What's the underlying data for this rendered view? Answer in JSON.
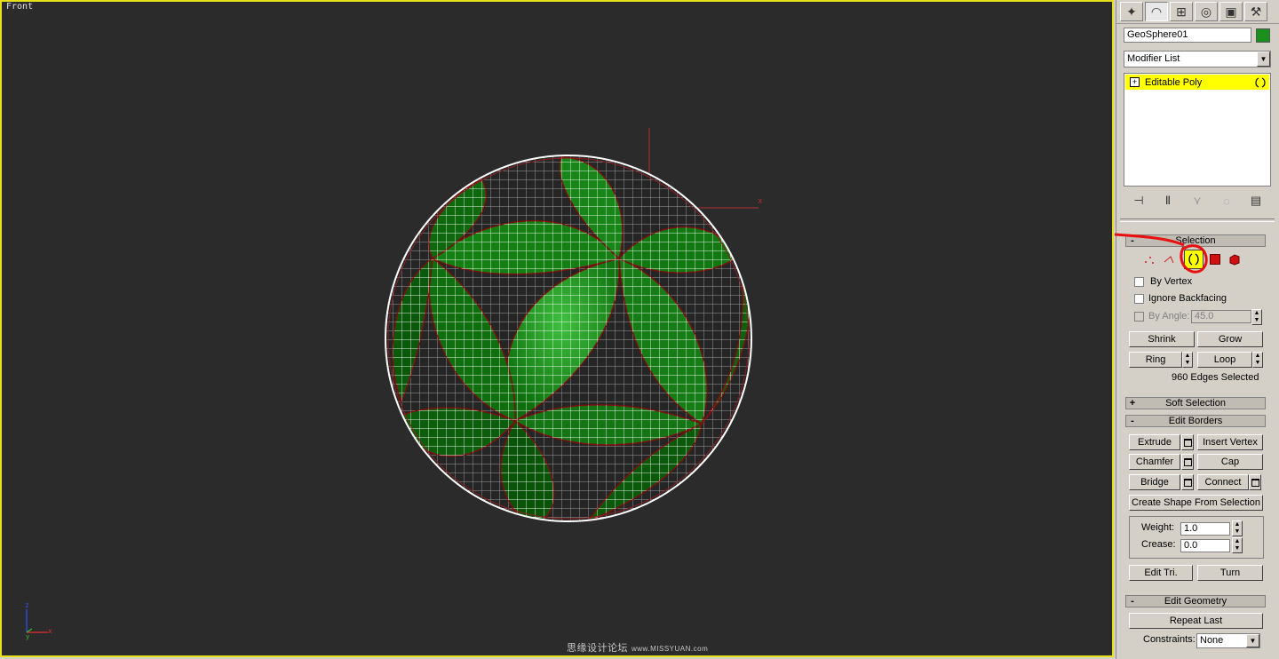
{
  "viewport": {
    "label": "Front",
    "watermark": "思缘设计论坛",
    "watermark_url": "www.MISSYUAN.com",
    "axis": {
      "x": "x",
      "y": "y",
      "z": "z"
    }
  },
  "panel": {
    "tabs": [
      "create-icon",
      "modify-icon",
      "hierarchy-icon",
      "motion-icon",
      "display-icon",
      "utilities-icon"
    ],
    "object_name": "GeoSphere01",
    "object_color": "#1b8f1b",
    "modifier_list": "Modifier List",
    "stack": {
      "item": "Editable Poly"
    },
    "selection": {
      "header": "Selection",
      "by_vertex": "By Vertex",
      "ignore_backfacing": "Ignore Backfacing",
      "by_angle": "By Angle:",
      "by_angle_value": "45.0",
      "shrink": "Shrink",
      "grow": "Grow",
      "ring": "Ring",
      "loop": "Loop",
      "status": "960 Edges Selected"
    },
    "soft_selection": {
      "header": "Soft Selection"
    },
    "edit_borders": {
      "header": "Edit Borders",
      "extrude": "Extrude",
      "insert_vertex": "Insert Vertex",
      "chamfer": "Chamfer",
      "cap": "Cap",
      "bridge": "Bridge",
      "connect": "Connect",
      "create_shape": "Create Shape From Selection",
      "weight_label": "Weight:",
      "weight_value": "1.0",
      "crease_label": "Crease:",
      "crease_value": "0.0",
      "edit_tri": "Edit Tri.",
      "turn": "Turn"
    },
    "edit_geometry": {
      "header": "Edit Geometry",
      "repeat_last": "Repeat Last",
      "constraints_label": "Constraints:",
      "constraints_value": "None"
    }
  }
}
